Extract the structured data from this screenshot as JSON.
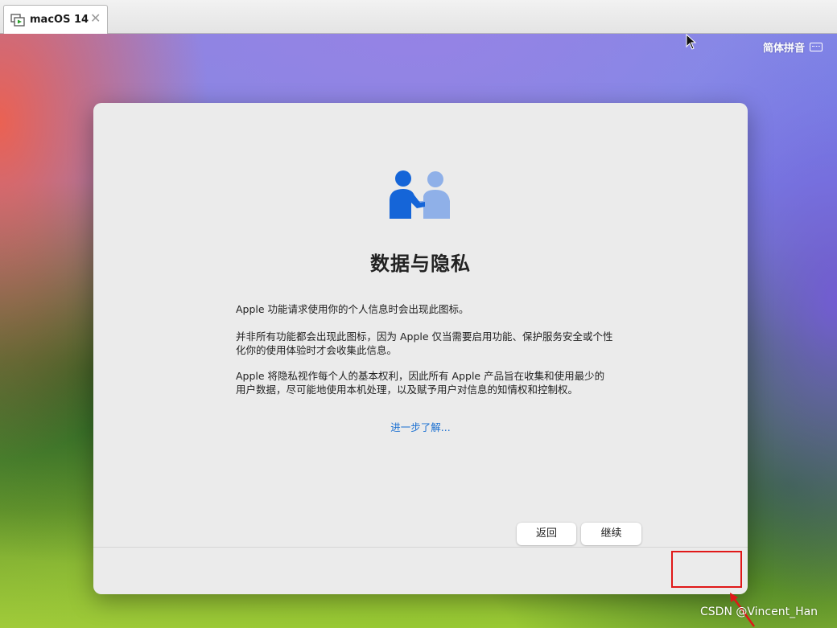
{
  "vm_tab": {
    "title": "macOS 14",
    "close_glyph": "✕",
    "icon": "vm-screen-icon"
  },
  "desktop": {
    "input_method_label": "简体拼音",
    "input_method_icon": "keyboard-icon"
  },
  "dialog": {
    "hero_icon": "privacy-handshake-icon",
    "title": "数据与隐私",
    "paragraphs": [
      "Apple 功能请求使用你的个人信息时会出现此图标。",
      "并非所有功能都会出现此图标，因为 Apple 仅当需要启用功能、保护服务安全或个性化你的使用体验时才会收集此信息。",
      "Apple 将隐私视作每个人的基本权利，因此所有 Apple 产品旨在收集和使用最少的用户数据，尽可能地使用本机处理，以及赋予用户对信息的知情权和控制权。"
    ],
    "learn_more": "进一步了解...",
    "buttons": {
      "back": "返回",
      "continue": "继续"
    }
  },
  "annotation": {
    "highlight_color": "#e01818",
    "watermark": "CSDN @Vincent_Han"
  },
  "colors": {
    "accent_blue": "#1a6fd1",
    "icon_dark_blue": "#1565d8",
    "icon_light_blue": "#8fb0e8"
  }
}
